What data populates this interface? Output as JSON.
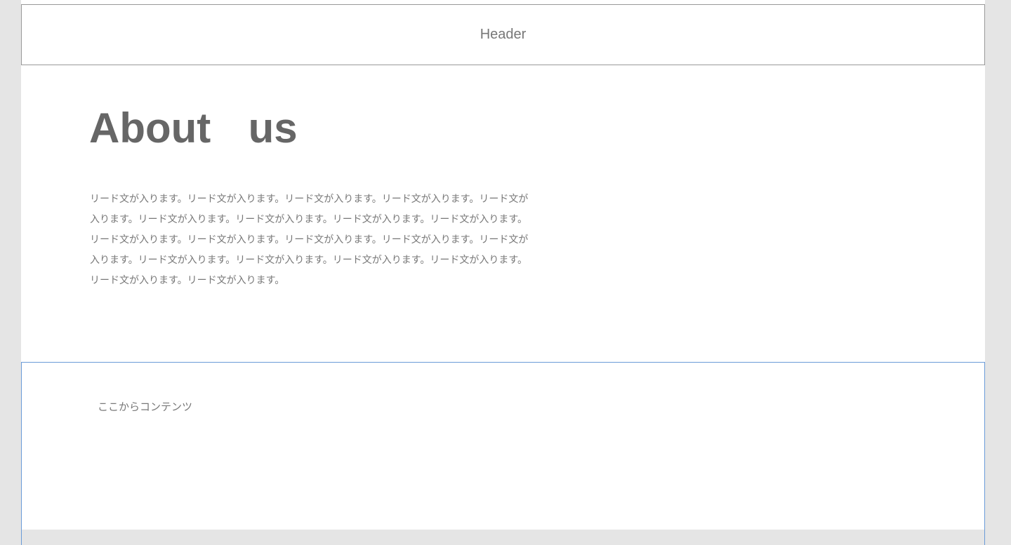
{
  "header": {
    "label": "Header"
  },
  "hero": {
    "title": "About  us",
    "lead_lines": [
      "リード文が入ります。リード文が入ります。リード文が入ります。リード文が入ります。リード文が",
      "入ります。リード文が入ります。リード文が入ります。リード文が入ります。リード文が入ります。",
      "リード文が入ります。リード文が入ります。リード文が入ります。リード文が入ります。リード文が",
      "入ります。リード文が入ります。リード文が入ります。リード文が入ります。リード文が入ります。",
      "リード文が入ります。リード文が入ります。"
    ]
  },
  "content": {
    "label": "ここからコンテンツ"
  },
  "colors": {
    "background": "#e5e5e5",
    "content_border": "#6a9bd8",
    "header_border": "#999999"
  }
}
